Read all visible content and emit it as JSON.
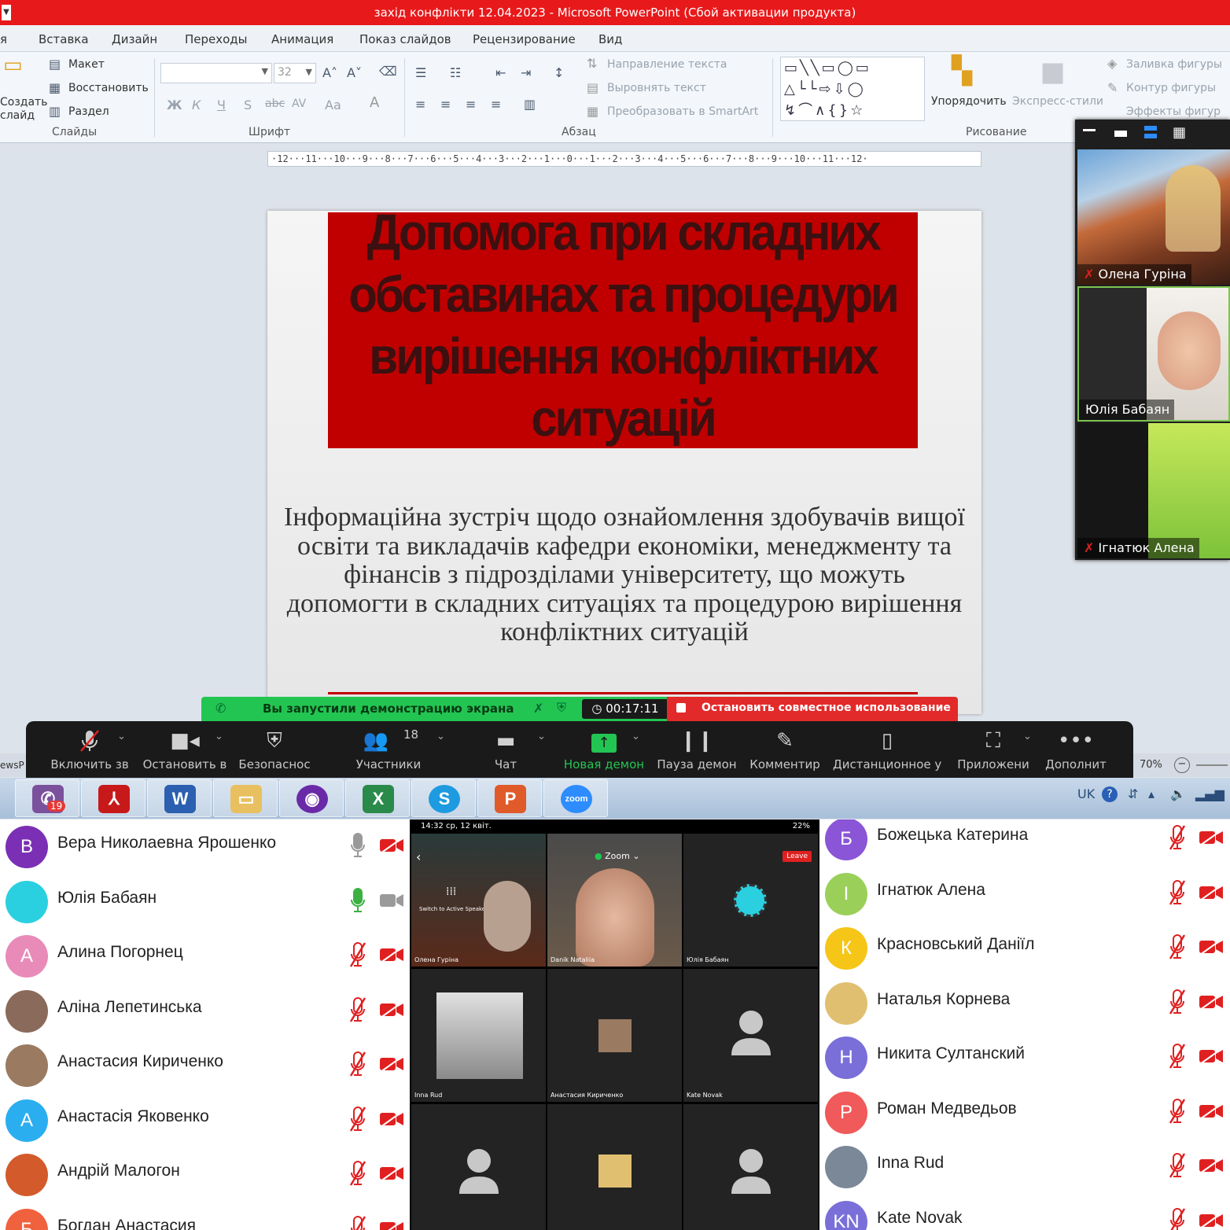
{
  "window": {
    "title": "захід конфлікти 12.04.2023  -  Microsoft PowerPoint (Сбой активации продукта)"
  },
  "tabs": [
    "я",
    "Вставка",
    "Дизайн",
    "Переходы",
    "Анимация",
    "Показ слайдов",
    "Рецензирование",
    "Вид"
  ],
  "ribbon": {
    "create_slide_1": "Создать",
    "create_slide_2": "слайд",
    "layout": "Макет",
    "reset": "Восстановить",
    "section": "Раздел",
    "group_slides": "Слайды",
    "font_size": "32",
    "group_font": "Шрифт",
    "group_paragraph": "Абзац",
    "text_direction": "Направление текста",
    "align_text": "Выровнять текст",
    "smartart": "Преобразовать в SmartArt",
    "arrange": "Упорядочить",
    "quick_styles": "Экспресс-стили",
    "shape_fill": "Заливка фигуры",
    "shape_outline": "Контур фигуры",
    "shape_effects": "Эффекты фигур",
    "group_drawing": "Рисование",
    "bold": "Ж",
    "italic": "К",
    "underline": "Ч",
    "shadow": "S",
    "strike": "abc",
    "spacing": "AV",
    "case": "Aa"
  },
  "ruler": {
    "text": "·12···11···10···9···8···7···6···5···4···3···2···1···0···1···2···3···4···5···6···7···8···9···10···11···12·"
  },
  "slide": {
    "title": "Допомога при складних обставинах та процедури вирішення конфліктних ситуацій",
    "body": "Інформаційна зустріч щодо ознайомлення здобувачів вищої освіти та викладачів кафедри економіки, менеджменту та фінансів з підрозділами університету, що можуть допомогти в складних ситуаціях та процедурою вирішення конфліктних ситуацій"
  },
  "share_bar": {
    "status": "Вы запустили демонстрацию экрана",
    "timer": "00:17:11",
    "stop": "Остановить совместное использование"
  },
  "zoom_toolbar": {
    "mute": "Включить зв",
    "video": "Остановить в",
    "security": "Безопаснос",
    "participants": "Участники",
    "participants_count": "18",
    "chat": "Чат",
    "new_share": "Новая демон",
    "pause_share": "Пауза демон",
    "annotate": "Комментир",
    "remote_control": "Дистанционное у",
    "apps": "Приложени",
    "more": "Дополнит"
  },
  "status_bar": {
    "left": "ewsP",
    "zoom": "70%"
  },
  "taskbar": {
    "apps": [
      "viber",
      "acrobat",
      "word",
      "explorer",
      "tor",
      "excel",
      "skype",
      "powerpoint",
      "zoom"
    ],
    "viber_badge": "19",
    "zoom_label": "zoom",
    "lang": "UK"
  },
  "video_panel": {
    "tiles": [
      "Олена Гуріна",
      "Юлія Бабаян",
      "Ігнатюк Алена"
    ]
  },
  "participants_left": [
    {
      "initial": "В",
      "name": "Вера Николаевна Ярошенко",
      "color": "#7b2fb5",
      "mic": "on",
      "cam": "off"
    },
    {
      "initial": "",
      "name": "Юлія Бабаян",
      "color": "#2bd0e0",
      "mic": "active",
      "cam": "on"
    },
    {
      "initial": "А",
      "name": "Алина Погорнец",
      "color": "#e88bb8",
      "mic": "off",
      "cam": "off"
    },
    {
      "initial": "",
      "name": "Аліна Лепетинська",
      "color": "#8a6a5a",
      "mic": "off",
      "cam": "off"
    },
    {
      "initial": "",
      "name": "Анастасия Кириченко",
      "color": "#9a7a60",
      "mic": "off",
      "cam": "off"
    },
    {
      "initial": "А",
      "name": "Анастасія Яковенко",
      "color": "#2aaef0",
      "mic": "off",
      "cam": "off"
    },
    {
      "initial": "",
      "name": "Андрій Малогон",
      "color": "#d35a2a",
      "mic": "off",
      "cam": "off"
    },
    {
      "initial": "Б",
      "name": "Богдан Анастасия",
      "color": "#f0623e",
      "mic": "off",
      "cam": "off"
    }
  ],
  "participants_right": [
    {
      "initial": "Б",
      "name": "Божецька Катерина",
      "color": "#8a55d6",
      "mic": "off",
      "cam": "off"
    },
    {
      "initial": "І",
      "name": "Ігнатюк Алена",
      "color": "#9ad05a",
      "mic": "off",
      "cam": "off"
    },
    {
      "initial": "К",
      "name": "Красновський Даніїл",
      "color": "#f5c518",
      "mic": "off",
      "cam": "off"
    },
    {
      "initial": "",
      "name": "Наталья Корнева",
      "color": "#e0c070",
      "mic": "off",
      "cam": "off"
    },
    {
      "initial": "Н",
      "name": "Никита Султанский",
      "color": "#7a6fd8",
      "mic": "off",
      "cam": "off"
    },
    {
      "initial": "Р",
      "name": "Роман Медведьов",
      "color": "#f05a5a",
      "mic": "off",
      "cam": "off"
    },
    {
      "initial": "",
      "name": "Inna Rud",
      "color": "#7a8898",
      "mic": "off",
      "cam": "off"
    },
    {
      "initial": "KN",
      "name": "Kate Novak",
      "color": "#7a6fd8",
      "mic": "off",
      "cam": "off"
    }
  ],
  "phone": {
    "status_time": "14:32  ср, 12 квіт.",
    "battery": "22%",
    "zoom_label": "Zoom",
    "leave": "Leave",
    "switch_speaker": "Switch to Active Speaker",
    "cells": [
      "Олена Гуріна",
      "Danik Nataliia",
      "Юлія Бабаян",
      "Inna Rud",
      "Анастасия Кириченко",
      "Kate Novak",
      "",
      "",
      ""
    ]
  },
  "colors": {
    "title_bar": "#e8191b",
    "slide_title_box": "#c00000",
    "share_green": "#23c552",
    "share_red": "#e22a2a",
    "mic_off_red": "#e02020"
  }
}
